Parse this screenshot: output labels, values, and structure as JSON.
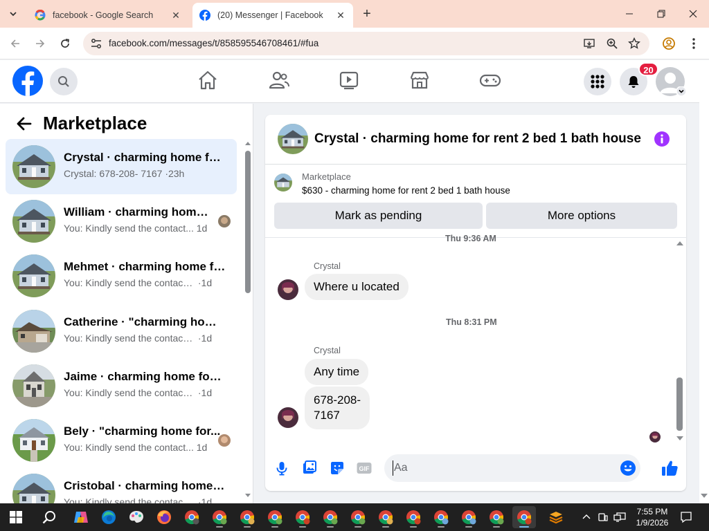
{
  "browser": {
    "tabs": [
      {
        "title": "facebook - Google Search",
        "active": false
      },
      {
        "title": "(20) Messenger | Facebook",
        "active": true
      }
    ],
    "url": "facebook.com/messages/t/858595546708461/#fua"
  },
  "header": {
    "notification_count": "20"
  },
  "sidebar": {
    "title": "Marketplace",
    "conversations": [
      {
        "name": "Crystal · charming home for ...",
        "preview": "Crystal: 678-208- 7167",
        "time": "·23h",
        "selected": true
      },
      {
        "name": "William · charming home ...",
        "preview": "You: Kindly send the contact...",
        "time": "1d",
        "selected": false
      },
      {
        "name": "Mehmet · charming home fo...",
        "preview": "You: Kindly send the contact n...",
        "time": "·1d",
        "selected": false
      },
      {
        "name": "Catherine · \"charming home...",
        "preview": "You: Kindly send the contact n...",
        "time": "·1d",
        "selected": false
      },
      {
        "name": "Jaime · charming home for r...",
        "preview": "You: Kindly send the contact n...",
        "time": "·1d",
        "selected": false
      },
      {
        "name": "Bely · \"charming home for...",
        "preview": "You: Kindly send the contact...",
        "time": "1d",
        "selected": false
      },
      {
        "name": "Cristobal · charming home f...",
        "preview": "You: Kindly send the contact n...",
        "time": "·1d",
        "selected": false
      }
    ]
  },
  "chat": {
    "title": "Crystal · charming home for rent 2 bed 1 bath house",
    "marketplace_label": "Marketplace",
    "listing": "$630 - charming home for rent 2 bed 1 bath house",
    "mark_pending": "Mark as pending",
    "more_options": "More options",
    "timestamp_top": "Thu 9:36 AM",
    "sender1": "Crystal",
    "message1": "Where u located",
    "timestamp_mid": "Thu 8:31 PM",
    "sender2": "Crystal",
    "message2": "Any time",
    "message3_line1": "678-208-",
    "message3_line2": "7167",
    "composer_placeholder": "Aa"
  },
  "taskbar": {
    "time": "7:55 PM",
    "date": "1/9/2026"
  },
  "colors": {
    "facebook_blue": "#0866ff",
    "messenger_purple": "#a033ff",
    "badge_red": "#e41e3f",
    "tabstrip": "#fadcd0"
  }
}
